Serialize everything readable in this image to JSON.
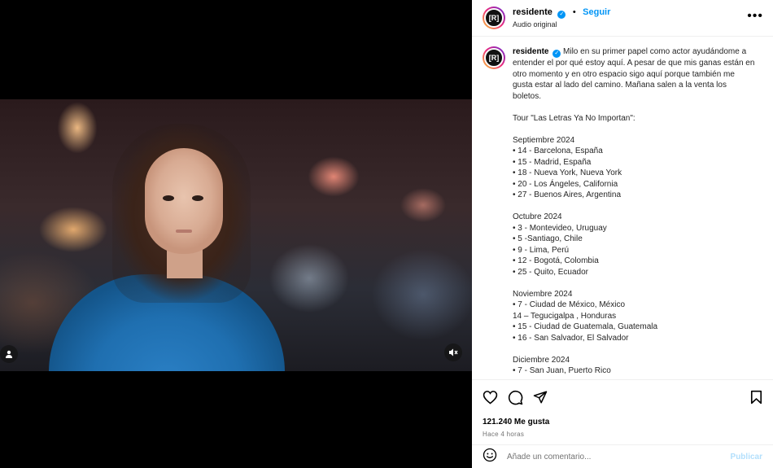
{
  "post": {
    "username": "residente",
    "avatar_text": "[R]",
    "follow_label": "Seguir",
    "audio_label": "Audio original",
    "more_icon": "more-horizontal-icon",
    "dot_separator": "•"
  },
  "caption": {
    "username": "residente",
    "text": "Milo en su primer papel como actor ayudándome a entender el por qué estoy aquí. A pesar de que mis ganas están en otro momento y en otro espacio sigo aquí porque también me gusta estar al lado del camino. Mañana salen a la venta los boletos.\n\nTour \"Las Letras Ya No Importan\":\n\nSeptiembre 2024\n• 14 - Barcelona, España\n• 15 - Madrid, España\n• 18 - Nueva York, Nueva York\n• 20 - Los Ángeles, California\n• 27 - Buenos Aires, Argentina\n\nOctubre 2024\n• 3 - Montevideo, Uruguay\n• 5 -Santiago, Chile\n• 9 - Lima, Perú\n• 12 - Bogotá, Colombia\n• 25 - Quito, Ecuador\n\nNoviembre 2024\n• 7 - Ciudad de México, México\n14 – Tegucigalpa , Honduras\n• 15 - Ciudad de Guatemala, Guatemala\n• 16 - San Salvador, El Salvador\n\nDiciembre 2024\n• 7 - San Juan, Puerto Rico"
  },
  "engagement": {
    "likes": "121.240 Me gusta",
    "time": "Hace 4 horas"
  },
  "comment": {
    "placeholder": "Añade un comentario...",
    "post_label": "Publicar"
  },
  "colors": {
    "link_blue": "#0095f6",
    "verified_blue": "#0095f6",
    "post_disabled": "#b2dffc"
  }
}
